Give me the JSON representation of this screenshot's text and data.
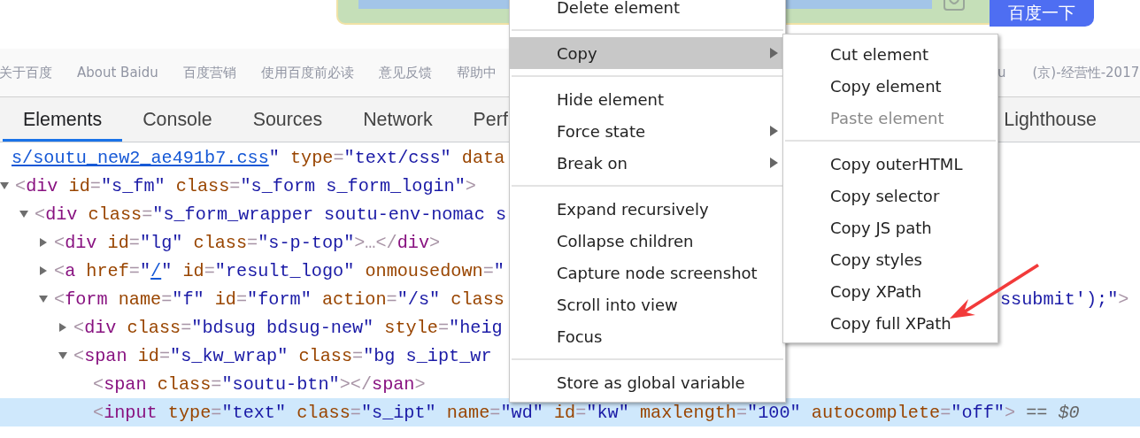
{
  "search": {
    "button": "百度一下"
  },
  "footer_links": {
    "left": [
      "关于百度",
      "About Baidu",
      "百度营销",
      "使用百度前必读",
      "意见反馈",
      "帮助中"
    ],
    "right": [
      "u",
      "(京)-经营性-2017"
    ]
  },
  "devtools_tabs": {
    "left": [
      {
        "label": "Elements",
        "selected": true
      },
      {
        "label": "Console",
        "selected": false
      },
      {
        "label": "Sources",
        "selected": false
      },
      {
        "label": "Network",
        "selected": false
      },
      {
        "label": "Perf",
        "selected": false
      }
    ],
    "right": [
      {
        "label": "Lighthouse",
        "selected": false
      }
    ]
  },
  "tree": [
    {
      "selected": false,
      "segs": [
        {
          "kind": "l",
          "text": "s/soutu_new2_ae491b7.css"
        },
        {
          "kind": "v",
          "text": "\""
        },
        {
          "kind": "a",
          "text": " type"
        },
        {
          "kind": "p",
          "text": "="
        },
        {
          "kind": "v",
          "text": "\"text/css\""
        },
        {
          "kind": "a",
          "text": " data"
        }
      ]
    },
    {
      "selected": false,
      "expanded": true,
      "segs": [
        {
          "kind": "p",
          "text": "<"
        },
        {
          "kind": "g",
          "text": "div"
        },
        {
          "kind": "a",
          "text": " id"
        },
        {
          "kind": "p",
          "text": "="
        },
        {
          "kind": "v",
          "text": "\"s_fm\""
        },
        {
          "kind": "a",
          "text": " class"
        },
        {
          "kind": "p",
          "text": "="
        },
        {
          "kind": "v",
          "text": "\"s_form s_form_login\""
        },
        {
          "kind": "p",
          "text": ">"
        }
      ],
      "children": [
        {
          "selected": false,
          "expanded": true,
          "segs": [
            {
              "kind": "p",
              "text": "<"
            },
            {
              "kind": "g",
              "text": "div"
            },
            {
              "kind": "a",
              "text": " class"
            },
            {
              "kind": "p",
              "text": "="
            },
            {
              "kind": "v",
              "text": "\"s_form_wrapper soutu-env-nomac s"
            }
          ],
          "children": [
            {
              "selected": false,
              "expanded": false,
              "segs": [
                {
                  "kind": "p",
                  "text": "<"
                },
                {
                  "kind": "g",
                  "text": "div"
                },
                {
                  "kind": "a",
                  "text": " id"
                },
                {
                  "kind": "p",
                  "text": "="
                },
                {
                  "kind": "v",
                  "text": "\"lg\""
                },
                {
                  "kind": "a",
                  "text": " class"
                },
                {
                  "kind": "p",
                  "text": "="
                },
                {
                  "kind": "v",
                  "text": "\"s-p-top\""
                },
                {
                  "kind": "p",
                  "text": ">…</"
                },
                {
                  "kind": "g",
                  "text": "div"
                },
                {
                  "kind": "p",
                  "text": ">"
                }
              ]
            },
            {
              "selected": false,
              "expanded": false,
              "segs": [
                {
                  "kind": "p",
                  "text": "<"
                },
                {
                  "kind": "g",
                  "text": "a"
                },
                {
                  "kind": "a",
                  "text": " href"
                },
                {
                  "kind": "p",
                  "text": "="
                },
                {
                  "kind": "v",
                  "text": "\""
                },
                {
                  "kind": "l",
                  "text": "/"
                },
                {
                  "kind": "v",
                  "text": "\""
                },
                {
                  "kind": "a",
                  "text": " id"
                },
                {
                  "kind": "p",
                  "text": "="
                },
                {
                  "kind": "v",
                  "text": "\"result_logo\""
                },
                {
                  "kind": "a",
                  "text": " onmousedown"
                },
                {
                  "kind": "p",
                  "text": "="
                },
                {
                  "kind": "v",
                  "text": "\""
                }
              ]
            },
            {
              "selected": false,
              "expanded": true,
              "segs": [
                {
                  "kind": "p",
                  "text": "<"
                },
                {
                  "kind": "g",
                  "text": "form"
                },
                {
                  "kind": "a",
                  "text": " name"
                },
                {
                  "kind": "p",
                  "text": "="
                },
                {
                  "kind": "v",
                  "text": "\"f\""
                },
                {
                  "kind": "a",
                  "text": " id"
                },
                {
                  "kind": "p",
                  "text": "="
                },
                {
                  "kind": "v",
                  "text": "\"form\""
                },
                {
                  "kind": "a",
                  "text": " action"
                },
                {
                  "kind": "p",
                  "text": "="
                },
                {
                  "kind": "v",
                  "text": "\"/s\""
                },
                {
                  "kind": "a",
                  "text": " class"
                }
              ],
              "tail": [
                {
                  "kind": "v",
                  "text": "ssubmit');\""
                },
                {
                  "kind": "p",
                  "text": ">"
                }
              ],
              "children": [
                {
                  "selected": false,
                  "expanded": false,
                  "segs": [
                    {
                      "kind": "p",
                      "text": "<"
                    },
                    {
                      "kind": "g",
                      "text": "div"
                    },
                    {
                      "kind": "a",
                      "text": " class"
                    },
                    {
                      "kind": "p",
                      "text": "="
                    },
                    {
                      "kind": "v",
                      "text": "\"bdsug bdsug-new\""
                    },
                    {
                      "kind": "a",
                      "text": " style"
                    },
                    {
                      "kind": "p",
                      "text": "="
                    },
                    {
                      "kind": "v",
                      "text": "\"heig"
                    }
                  ]
                },
                {
                  "selected": false,
                  "expanded": true,
                  "segs": [
                    {
                      "kind": "p",
                      "text": "<"
                    },
                    {
                      "kind": "g",
                      "text": "span"
                    },
                    {
                      "kind": "a",
                      "text": " id"
                    },
                    {
                      "kind": "p",
                      "text": "="
                    },
                    {
                      "kind": "v",
                      "text": "\"s_kw_wrap\""
                    },
                    {
                      "kind": "a",
                      "text": " class"
                    },
                    {
                      "kind": "p",
                      "text": "="
                    },
                    {
                      "kind": "v",
                      "text": "\"bg s_ipt_wr"
                    }
                  ],
                  "children": [
                    {
                      "selected": false,
                      "segs": [
                        {
                          "kind": "p",
                          "text": "<"
                        },
                        {
                          "kind": "g",
                          "text": "span"
                        },
                        {
                          "kind": "a",
                          "text": " class"
                        },
                        {
                          "kind": "p",
                          "text": "="
                        },
                        {
                          "kind": "v",
                          "text": "\"soutu-btn\""
                        },
                        {
                          "kind": "p",
                          "text": "></"
                        },
                        {
                          "kind": "g",
                          "text": "span"
                        },
                        {
                          "kind": "p",
                          "text": ">"
                        }
                      ]
                    },
                    {
                      "selected": true,
                      "segs": [
                        {
                          "kind": "p",
                          "text": "<"
                        },
                        {
                          "kind": "g",
                          "text": "input"
                        },
                        {
                          "kind": "a",
                          "text": " type"
                        },
                        {
                          "kind": "p",
                          "text": "="
                        },
                        {
                          "kind": "v",
                          "text": "\"text\""
                        },
                        {
                          "kind": "a",
                          "text": " class"
                        },
                        {
                          "kind": "p",
                          "text": "="
                        },
                        {
                          "kind": "v",
                          "text": "\"s_ipt\""
                        },
                        {
                          "kind": "a",
                          "text": " name"
                        },
                        {
                          "kind": "p",
                          "text": "="
                        },
                        {
                          "kind": "v",
                          "text": "\"wd\""
                        },
                        {
                          "kind": "a",
                          "text": " id"
                        },
                        {
                          "kind": "p",
                          "text": "="
                        },
                        {
                          "kind": "v",
                          "text": "\"kw\""
                        },
                        {
                          "kind": "a",
                          "text": " maxlength"
                        },
                        {
                          "kind": "p",
                          "text": "="
                        },
                        {
                          "kind": "v",
                          "text": "\"100\""
                        },
                        {
                          "kind": "a",
                          "text": " autocomplete"
                        },
                        {
                          "kind": "p",
                          "text": "="
                        },
                        {
                          "kind": "v",
                          "text": "\"off\""
                        },
                        {
                          "kind": "p",
                          "text": ">"
                        },
                        {
                          "kind": "t",
                          "text": " == $0"
                        }
                      ]
                    }
                  ]
                }
              ]
            }
          ]
        }
      ]
    }
  ],
  "context_menu": {
    "items": [
      {
        "kind": "item",
        "label": "Delete element",
        "selected": false,
        "has_submenu": false,
        "disabled": false
      },
      {
        "kind": "separator"
      },
      {
        "kind": "item",
        "label": "Copy",
        "selected": true,
        "has_submenu": true,
        "disabled": false
      },
      {
        "kind": "separator"
      },
      {
        "kind": "item",
        "label": "Hide element",
        "selected": false,
        "has_submenu": false,
        "disabled": false
      },
      {
        "kind": "item",
        "label": "Force state",
        "selected": false,
        "has_submenu": true,
        "disabled": false
      },
      {
        "kind": "item",
        "label": "Break on",
        "selected": false,
        "has_submenu": true,
        "disabled": false
      },
      {
        "kind": "separator"
      },
      {
        "kind": "item",
        "label": "Expand recursively",
        "selected": false,
        "has_submenu": false,
        "disabled": false
      },
      {
        "kind": "item",
        "label": "Collapse children",
        "selected": false,
        "has_submenu": false,
        "disabled": false
      },
      {
        "kind": "item",
        "label": "Capture node screenshot",
        "selected": false,
        "has_submenu": false,
        "disabled": false
      },
      {
        "kind": "item",
        "label": "Scroll into view",
        "selected": false,
        "has_submenu": false,
        "disabled": false
      },
      {
        "kind": "item",
        "label": "Focus",
        "selected": false,
        "has_submenu": false,
        "disabled": false
      },
      {
        "kind": "separator"
      },
      {
        "kind": "item",
        "label": "Store as global variable",
        "selected": false,
        "has_submenu": false,
        "disabled": false
      }
    ]
  },
  "copy_submenu": {
    "items": [
      {
        "kind": "item",
        "label": "Cut element",
        "selected": false,
        "has_submenu": false,
        "disabled": false
      },
      {
        "kind": "item",
        "label": "Copy element",
        "selected": false,
        "has_submenu": false,
        "disabled": false
      },
      {
        "kind": "item",
        "label": "Paste element",
        "selected": false,
        "has_submenu": false,
        "disabled": true
      },
      {
        "kind": "separator"
      },
      {
        "kind": "item",
        "label": "Copy outerHTML",
        "selected": false,
        "has_submenu": false,
        "disabled": false
      },
      {
        "kind": "item",
        "label": "Copy selector",
        "selected": false,
        "has_submenu": false,
        "disabled": false
      },
      {
        "kind": "item",
        "label": "Copy JS path",
        "selected": false,
        "has_submenu": false,
        "disabled": false
      },
      {
        "kind": "item",
        "label": "Copy styles",
        "selected": false,
        "has_submenu": false,
        "disabled": false
      },
      {
        "kind": "item",
        "label": "Copy XPath",
        "selected": false,
        "has_submenu": false,
        "disabled": false
      },
      {
        "kind": "item",
        "label": "Copy full XPath",
        "selected": false,
        "has_submenu": false,
        "disabled": false
      }
    ]
  }
}
